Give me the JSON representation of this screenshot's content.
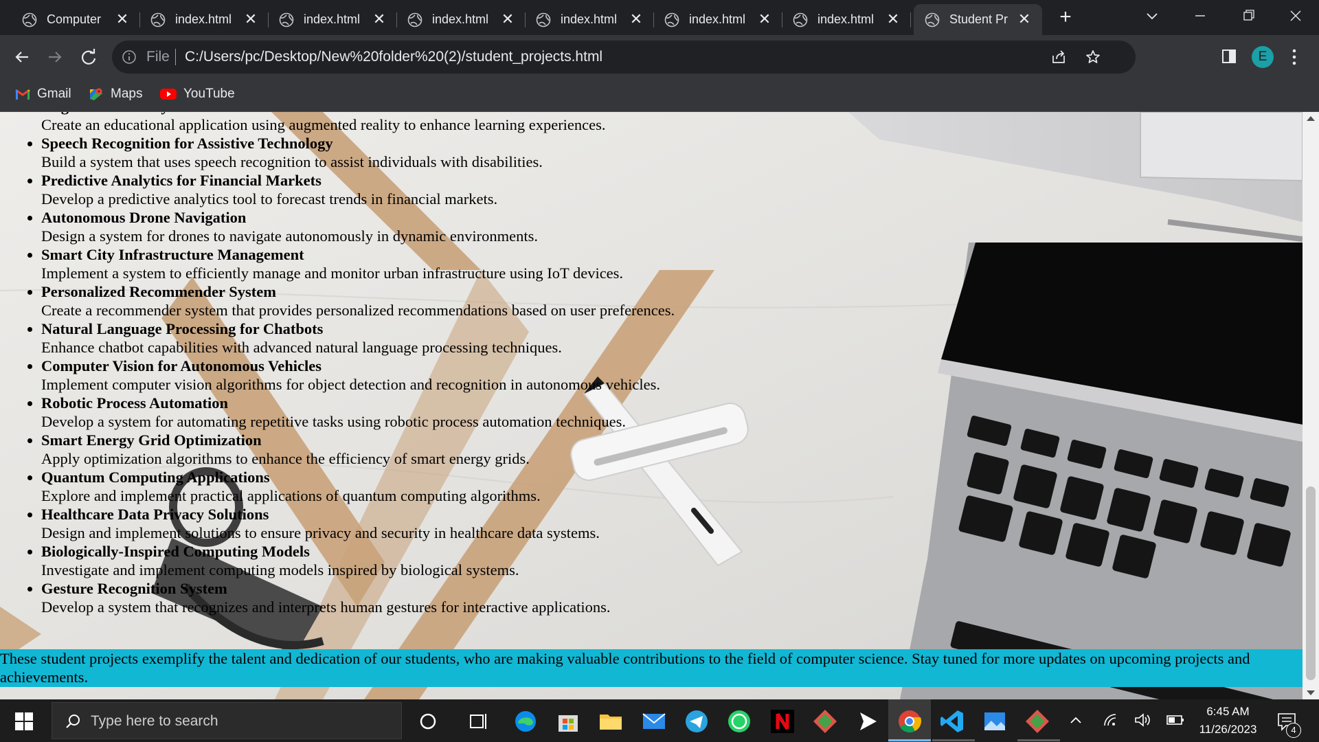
{
  "browser": {
    "tabs": [
      {
        "label": "Computer",
        "active": false
      },
      {
        "label": "index.html",
        "active": false
      },
      {
        "label": "index.html",
        "active": false
      },
      {
        "label": "index.html",
        "active": false
      },
      {
        "label": "index.html",
        "active": false
      },
      {
        "label": "index.html",
        "active": false
      },
      {
        "label": "index.html",
        "active": false
      },
      {
        "label": "Student Pr",
        "active": true
      }
    ],
    "omnibox": {
      "scheme_label": "File",
      "url": "C:/Users/pc/Desktop/New%20folder%20(2)/student_projects.html"
    },
    "profile_initial": "E",
    "bookmarks": [
      {
        "label": "Gmail",
        "icon": "gmail-icon"
      },
      {
        "label": "Maps",
        "icon": "maps-icon"
      },
      {
        "label": "YouTube",
        "icon": "youtube-icon"
      }
    ]
  },
  "page": {
    "projects": [
      {
        "title": "Augmented Reality for Education",
        "description": "Create an educational application using augmented reality to enhance learning experiences."
      },
      {
        "title": "Speech Recognition for Assistive Technology",
        "description": "Build a system that uses speech recognition to assist individuals with disabilities."
      },
      {
        "title": "Predictive Analytics for Financial Markets",
        "description": "Develop a predictive analytics tool to forecast trends in financial markets."
      },
      {
        "title": "Autonomous Drone Navigation",
        "description": "Design a system for drones to navigate autonomously in dynamic environments."
      },
      {
        "title": "Smart City Infrastructure Management",
        "description": "Implement a system to efficiently manage and monitor urban infrastructure using IoT devices."
      },
      {
        "title": "Personalized Recommender System",
        "description": "Create a recommender system that provides personalized recommendations based on user preferences."
      },
      {
        "title": "Natural Language Processing for Chatbots",
        "description": "Enhance chatbot capabilities with advanced natural language processing techniques."
      },
      {
        "title": "Computer Vision for Autonomous Vehicles",
        "description": "Implement computer vision algorithms for object detection and recognition in autonomous vehicles."
      },
      {
        "title": "Robotic Process Automation",
        "description": "Develop a system for automating repetitive tasks using robotic process automation techniques."
      },
      {
        "title": "Smart Energy Grid Optimization",
        "description": "Apply optimization algorithms to enhance the efficiency of smart energy grids."
      },
      {
        "title": "Quantum Computing Applications",
        "description": "Explore and implement practical applications of quantum computing algorithms."
      },
      {
        "title": "Healthcare Data Privacy Solutions",
        "description": "Design and implement solutions to ensure privacy and security in healthcare data systems."
      },
      {
        "title": "Biologically-Inspired Computing Models",
        "description": "Investigate and implement computing models inspired by biological systems."
      },
      {
        "title": "Gesture Recognition System",
        "description": "Develop a system that recognizes and interprets human gestures for interactive applications."
      }
    ],
    "footer_text": "These student projects exemplify the talent and dedication of our students, who are making valuable contributions to the field of computer science. Stay tuned for more updates on upcoming projects and achievements.",
    "footer_color": "#12b7d4"
  },
  "taskbar": {
    "search_placeholder": "Type here to search",
    "time": "6:45 AM",
    "date": "11/26/2023",
    "notification_count": "4",
    "accent": "#76b9ed"
  }
}
